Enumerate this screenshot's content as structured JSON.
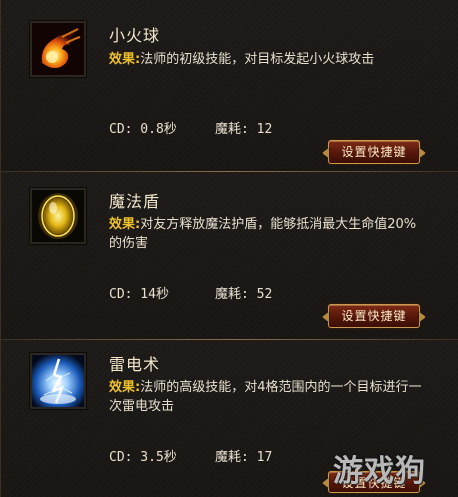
{
  "skills": [
    {
      "name": "小火球",
      "effect_label": "效果:",
      "description": "法师的初级技能，对目标发起小火球攻击",
      "cd_text": "CD: 0.8秒",
      "mana_text": "魔耗: 12",
      "button_label": "设置快捷键",
      "icon": "fireball-icon"
    },
    {
      "name": "魔法盾",
      "effect_label": "效果:",
      "description": "对友方释放魔法护盾，能够抵消最大生命值20%的伤害",
      "cd_text": "CD: 14秒",
      "mana_text": "魔耗: 52",
      "button_label": "设置快捷键",
      "icon": "magic-shield-icon"
    },
    {
      "name": "雷电术",
      "effect_label": "效果:",
      "description": "法师的高级技能，对4格范围内的一个目标进行一次雷电攻击",
      "cd_text": "CD: 3.5秒",
      "mana_text": "魔耗: 17",
      "button_label": "设置快捷键",
      "icon": "lightning-icon"
    }
  ],
  "watermark": "游戏狗",
  "colors": {
    "effect_label": "#f0c22a",
    "text": "#e8e0cf",
    "button": "#6a2210",
    "button_border": "#c89a4a"
  }
}
